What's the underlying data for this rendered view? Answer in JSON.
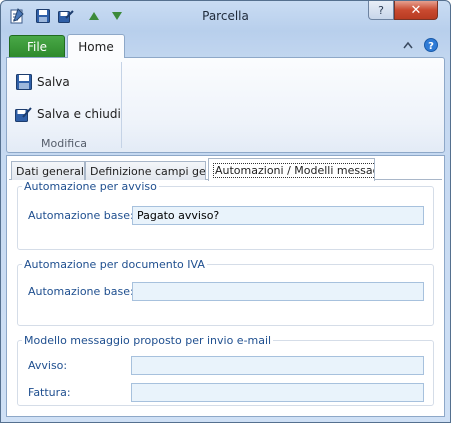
{
  "window": {
    "title": "Parcella",
    "help_btn": "?",
    "close_btn": "✕"
  },
  "ribbon": {
    "tab_file": "File",
    "tab_home": "Home",
    "buttons": {
      "save": "Salva",
      "save_close": "Salva e chiudi"
    },
    "group_label": "Modifica"
  },
  "tabs": [
    {
      "label": "Dati generali"
    },
    {
      "label": "Definizione campi gestiti"
    },
    {
      "label": "Automazioni / Modelli messaggio"
    }
  ],
  "groups": {
    "avviso": {
      "legend": "Automazione per avviso",
      "label": "Automazione base:",
      "value": "Pagato avviso?"
    },
    "doc_iva": {
      "legend": "Automazione per documento IVA",
      "label": "Automazione base:",
      "value": ""
    },
    "email": {
      "legend": "Modello messaggio proposto per invio e-mail",
      "avviso_label": "Avviso:",
      "avviso_value": "",
      "fattura_label": "Fattura:",
      "fattura_value": ""
    }
  },
  "colors": {
    "accent": "#1f4f8f",
    "file_tab": "#2e8a2c",
    "input_bg": "#e9f3fb"
  }
}
